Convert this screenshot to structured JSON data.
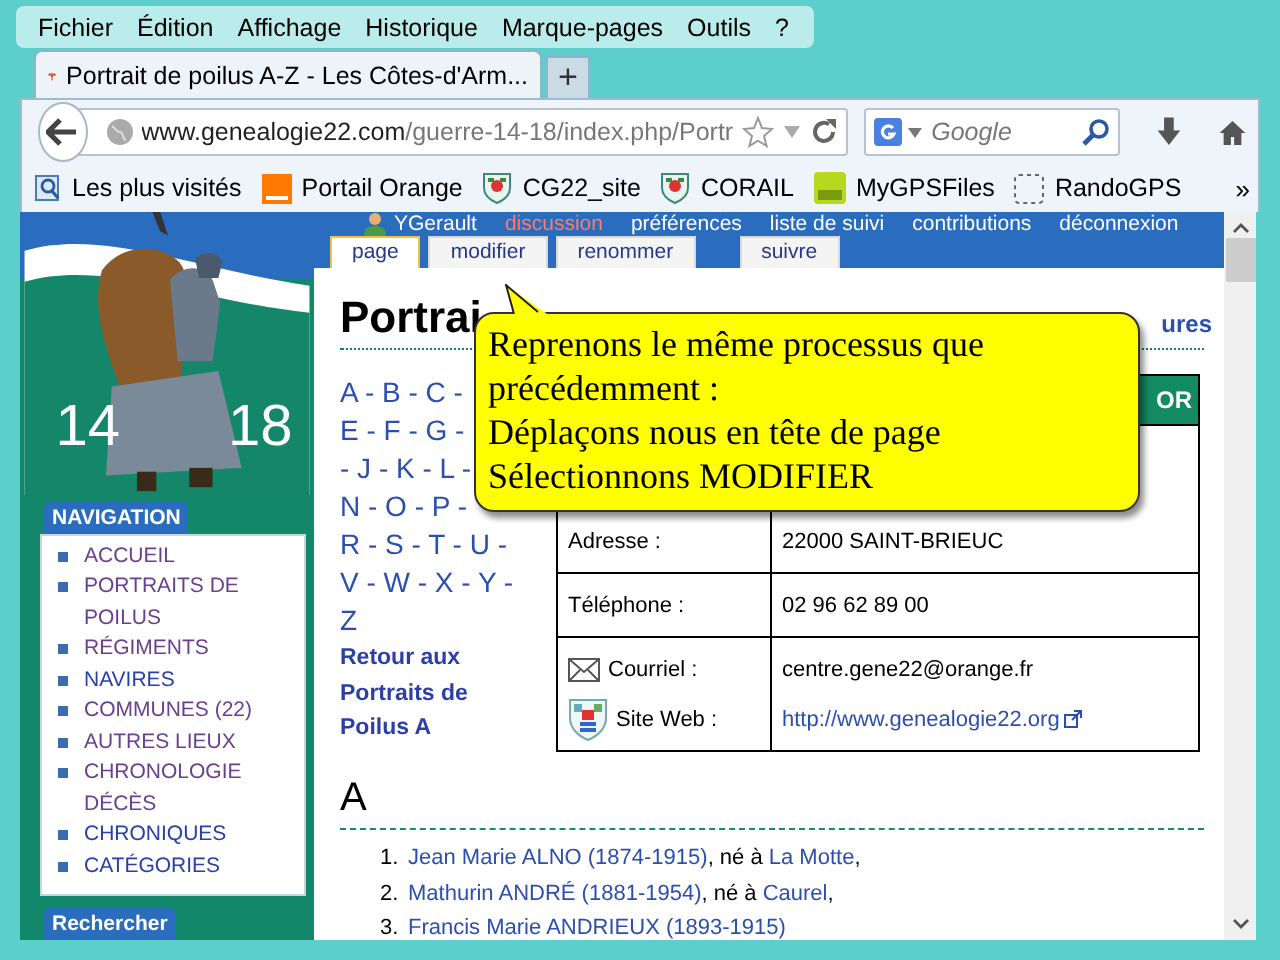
{
  "menu_bar": [
    "Fichier",
    "Édition",
    "Affichage",
    "Historique",
    "Marque-pages",
    "Outils",
    "?"
  ],
  "tabs": [
    {
      "title": "Portrait de poilus A-Z - Les Côtes-d'Arm...",
      "selected": true
    }
  ],
  "new_tab_button": "+",
  "address_bar": {
    "host": "www.genealogie22.com",
    "path": "/guerre-14-18/index.php/Portr"
  },
  "search": {
    "placeholder": "Google"
  },
  "bookmarks": [
    {
      "label": "Les plus visités",
      "kind": "history"
    },
    {
      "label": "Portail Orange",
      "kind": "orange"
    },
    {
      "label": "CG22_site",
      "kind": "crest"
    },
    {
      "label": "CORAIL",
      "kind": "crest"
    },
    {
      "label": "MyGPSFiles",
      "kind": "gps"
    },
    {
      "label": "RandoGPS",
      "kind": "blank"
    }
  ],
  "bookmarks_overflow": "»",
  "page": {
    "logo": {
      "left_year": "14",
      "right_year": "18"
    },
    "navigation": {
      "title": "NAVIGATION",
      "items": [
        {
          "label": "ACCUEIL",
          "visited": true
        },
        {
          "label": "PORTRAITS DE POILUS",
          "visited": true
        },
        {
          "label": "RÉGIMENTS",
          "visited": true
        },
        {
          "label": "NAVIRES",
          "visited": false
        },
        {
          "label": "COMMUNES (22)",
          "visited": true
        },
        {
          "label": "AUTRES LIEUX",
          "visited": true
        },
        {
          "label": "CHRONOLOGIE DÉCÈS",
          "visited": true
        },
        {
          "label": "CHRONIQUES",
          "visited": false
        },
        {
          "label": "CATÉGORIES",
          "visited": false
        }
      ]
    },
    "search_box": {
      "title": "Rechercher"
    },
    "user_links": [
      {
        "label": "YGerault",
        "kind": "user"
      },
      {
        "label": "discussion",
        "kind": "missing"
      },
      {
        "label": "préférences",
        "kind": "link"
      },
      {
        "label": "liste de suivi",
        "kind": "link"
      },
      {
        "label": "contributions",
        "kind": "link"
      },
      {
        "label": "déconnexion",
        "kind": "link"
      }
    ],
    "page_tabs": [
      {
        "label": "page",
        "selected": true
      },
      {
        "label": "modifier",
        "selected": false
      },
      {
        "label": "renommer",
        "selected": false
      },
      {
        "label": "suivre",
        "selected": false
      }
    ],
    "title": "Portrai",
    "title_side_link": "ures",
    "letter_index": [
      "A - B - C -",
      "E - F - G -",
      "- J - K - L -",
      "N - O - P -",
      "R - S - T - U -",
      "V - W - X - Y -",
      "Z"
    ],
    "back_link": "Retour aux Portraits de Poilus A",
    "contact_table": {
      "header": "OR",
      "rows": [
        {
          "entries": [
            {
              "kind": "plain",
              "label": "Adresse :",
              "value": "22000 SAINT-BRIEUC"
            }
          ]
        },
        {
          "entries": [
            {
              "kind": "plain",
              "label": "Téléphone :",
              "value": "02 96 62 89 00"
            }
          ]
        },
        {
          "entries": [
            {
              "kind": "email",
              "label": "Courriel :",
              "value": "centre.gene22@orange.fr"
            },
            {
              "kind": "web",
              "label": "Site Web :",
              "value": "http://www.genealogie22.org"
            }
          ]
        }
      ]
    },
    "section": {
      "heading": "A",
      "items": [
        {
          "number": "1.",
          "person": "Jean Marie ALNO (1874-1915)",
          "text": ", né à ",
          "place": "La Motte",
          "end": ","
        },
        {
          "number": "2.",
          "person": "Mathurin ANDRÉ (1881-1954)",
          "text": ", né à ",
          "place": "Caurel",
          "end": ","
        },
        {
          "number": "3.",
          "person": "Francis Marie ANDRIEUX (1893-1915)"
        }
      ]
    }
  },
  "callout": {
    "lines": [
      "Reprenons le même processus que précédemment :",
      "Déplaçons nous en tête de page",
      "Sélectionnons MODIFIER"
    ]
  }
}
